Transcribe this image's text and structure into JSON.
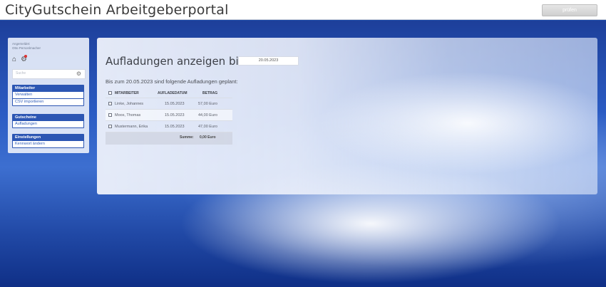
{
  "header": {
    "title": "CityGutschein Arbeitgeberportal",
    "button_label": "prüfen"
  },
  "sidebar": {
    "login_label": "Angemeldet:",
    "user_name": "Otto Personlmacher",
    "search_placeholder": "Suche",
    "groups": [
      {
        "title": "Mitarbeiter",
        "items": [
          "Verwalten",
          "CSV importieren"
        ]
      },
      {
        "title": "Gutscheine",
        "items": [
          "Aufladungen"
        ]
      },
      {
        "title": "Einstellungen",
        "items": [
          "Kennwort ändern"
        ]
      }
    ]
  },
  "main": {
    "title": "Aufladungen anzeigen bis zum",
    "date_value": "20.05.2023",
    "subtitle": "Bis zum 20.05.2023 sind folgende Aufladungen geplant:",
    "table": {
      "headers": [
        "MITARBEITER",
        "AUFLADEDATUM",
        "BETRAG"
      ],
      "rows": [
        [
          "Linke, Johannes",
          "15.05.2023",
          "57,00 Euro"
        ],
        [
          "Moos, Thomas",
          "15.05.2023",
          "44,00 Euro"
        ],
        [
          "Mustermann, Erika",
          "15.05.2023",
          "47,00 Euro"
        ]
      ],
      "sum_label": "Summe:",
      "sum_value": "0,00 Euro"
    }
  },
  "colors": {
    "accent": "#2c56b3",
    "background": "#1e4aa8"
  }
}
